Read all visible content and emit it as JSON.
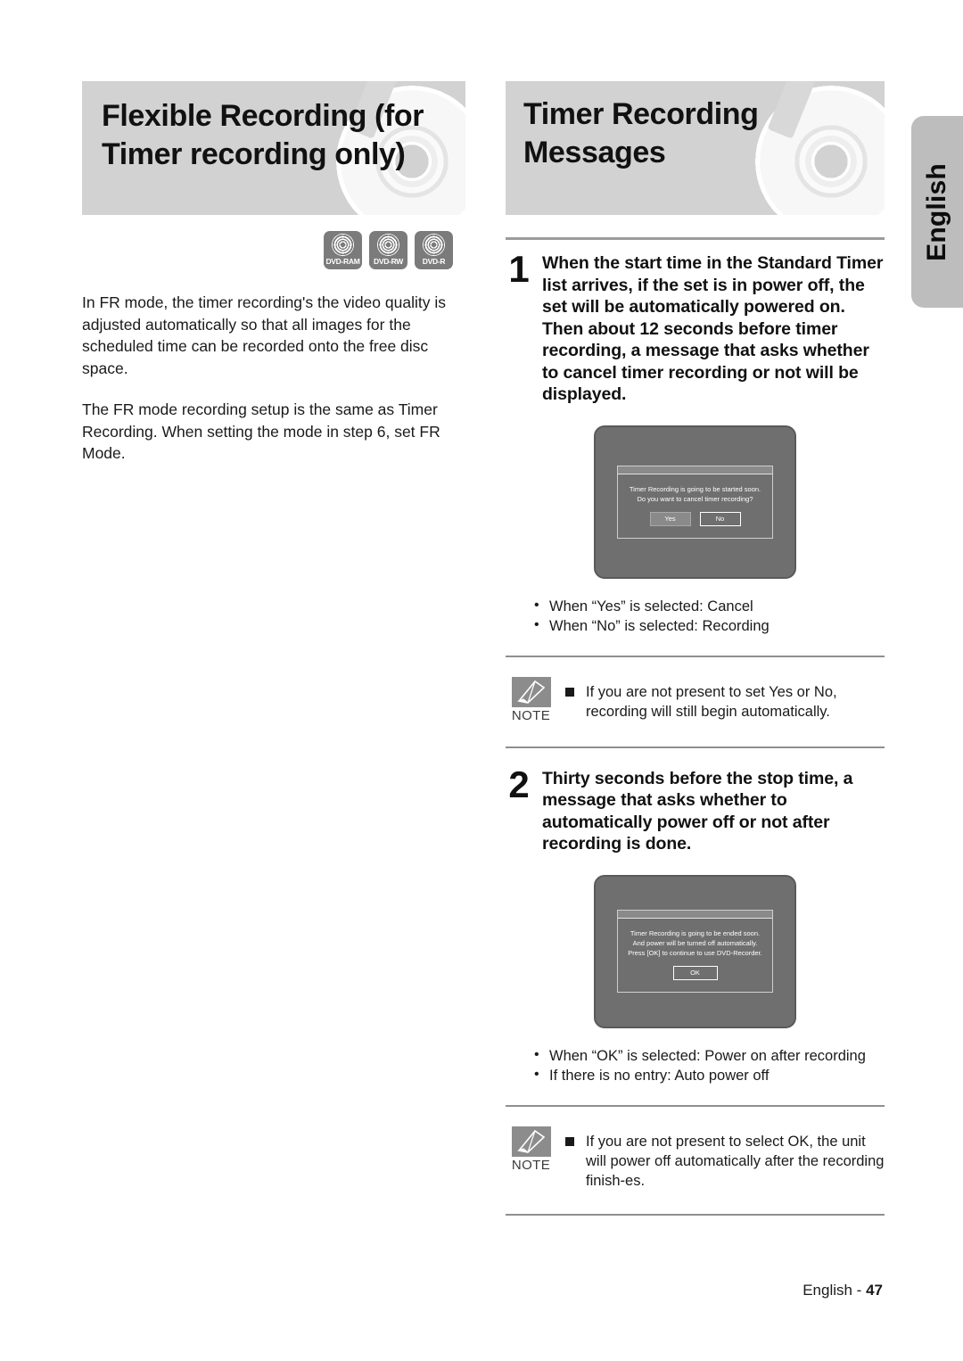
{
  "page": {
    "language_tab": "English",
    "footer_label": "English -",
    "footer_page": "47"
  },
  "left_column": {
    "header_title_line1": "Flexible Recording (for",
    "header_title_line2": "Timer recording only)",
    "disc_badges": [
      {
        "icon": "disc-icon",
        "label": "DVD-RAM"
      },
      {
        "icon": "disc-icon",
        "label": "DVD-RW"
      },
      {
        "icon": "disc-icon",
        "label": "DVD-R"
      }
    ],
    "paragraphs": [
      "In FR mode, the timer recording's the video quality is adjusted automatically so that all images for the scheduled time can be recorded onto the free disc space.",
      "The FR mode recording setup is the same as Timer Recording. When setting the mode in step 6, set FR Mode."
    ]
  },
  "right_column": {
    "header_title_line1": "Timer Recording",
    "header_title_line2": "Messages",
    "steps": [
      {
        "number": "1",
        "text": "When the start time in the Standard Timer list arrives, if the set is in power off, the set will be automatically powered on. Then about 12 seconds before timer recording, a message that asks whether to cancel timer recording or not will be displayed.",
        "screen": {
          "lines": [
            "Timer Recording is going to be started soon.",
            "Do you want to cancel timer recording?"
          ],
          "buttons": [
            {
              "label": "Yes",
              "focused": false
            },
            {
              "label": "No",
              "focused": true
            }
          ]
        },
        "bullets": [
          "When “Yes” is selected: Cancel",
          "When “No” is selected: Recording"
        ],
        "note": {
          "icon": "pencil-icon",
          "badge_label": "NOTE",
          "items": [
            "If you are not present to set Yes or No, recording will still begin automatically."
          ]
        }
      },
      {
        "number": "2",
        "text": "Thirty seconds before the stop time, a message that asks whether to automatically power off or not after recording is done.",
        "screen": {
          "lines": [
            "Timer Recording is going to be ended soon.",
            "And power will be turned off automatically.",
            "Press [OK] to continue to use DVD-Recorder."
          ],
          "buttons": [
            {
              "label": "OK",
              "focused": true
            }
          ]
        },
        "bullets": [
          "When “OK” is selected: Power on after recording",
          "If there is no entry: Auto power off"
        ],
        "note": {
          "icon": "pencil-icon",
          "badge_label": "NOTE",
          "items": [
            "If you are not present to select OK, the unit will power off automatically after the recording finish-es."
          ]
        }
      }
    ]
  },
  "colors": {
    "header_band": "#d2d2d2",
    "tab_background": "#bdbdbd",
    "badge_background": "#7b7b7b",
    "screen_background": "#6f6f6f",
    "rule": "#9b9b9b"
  }
}
